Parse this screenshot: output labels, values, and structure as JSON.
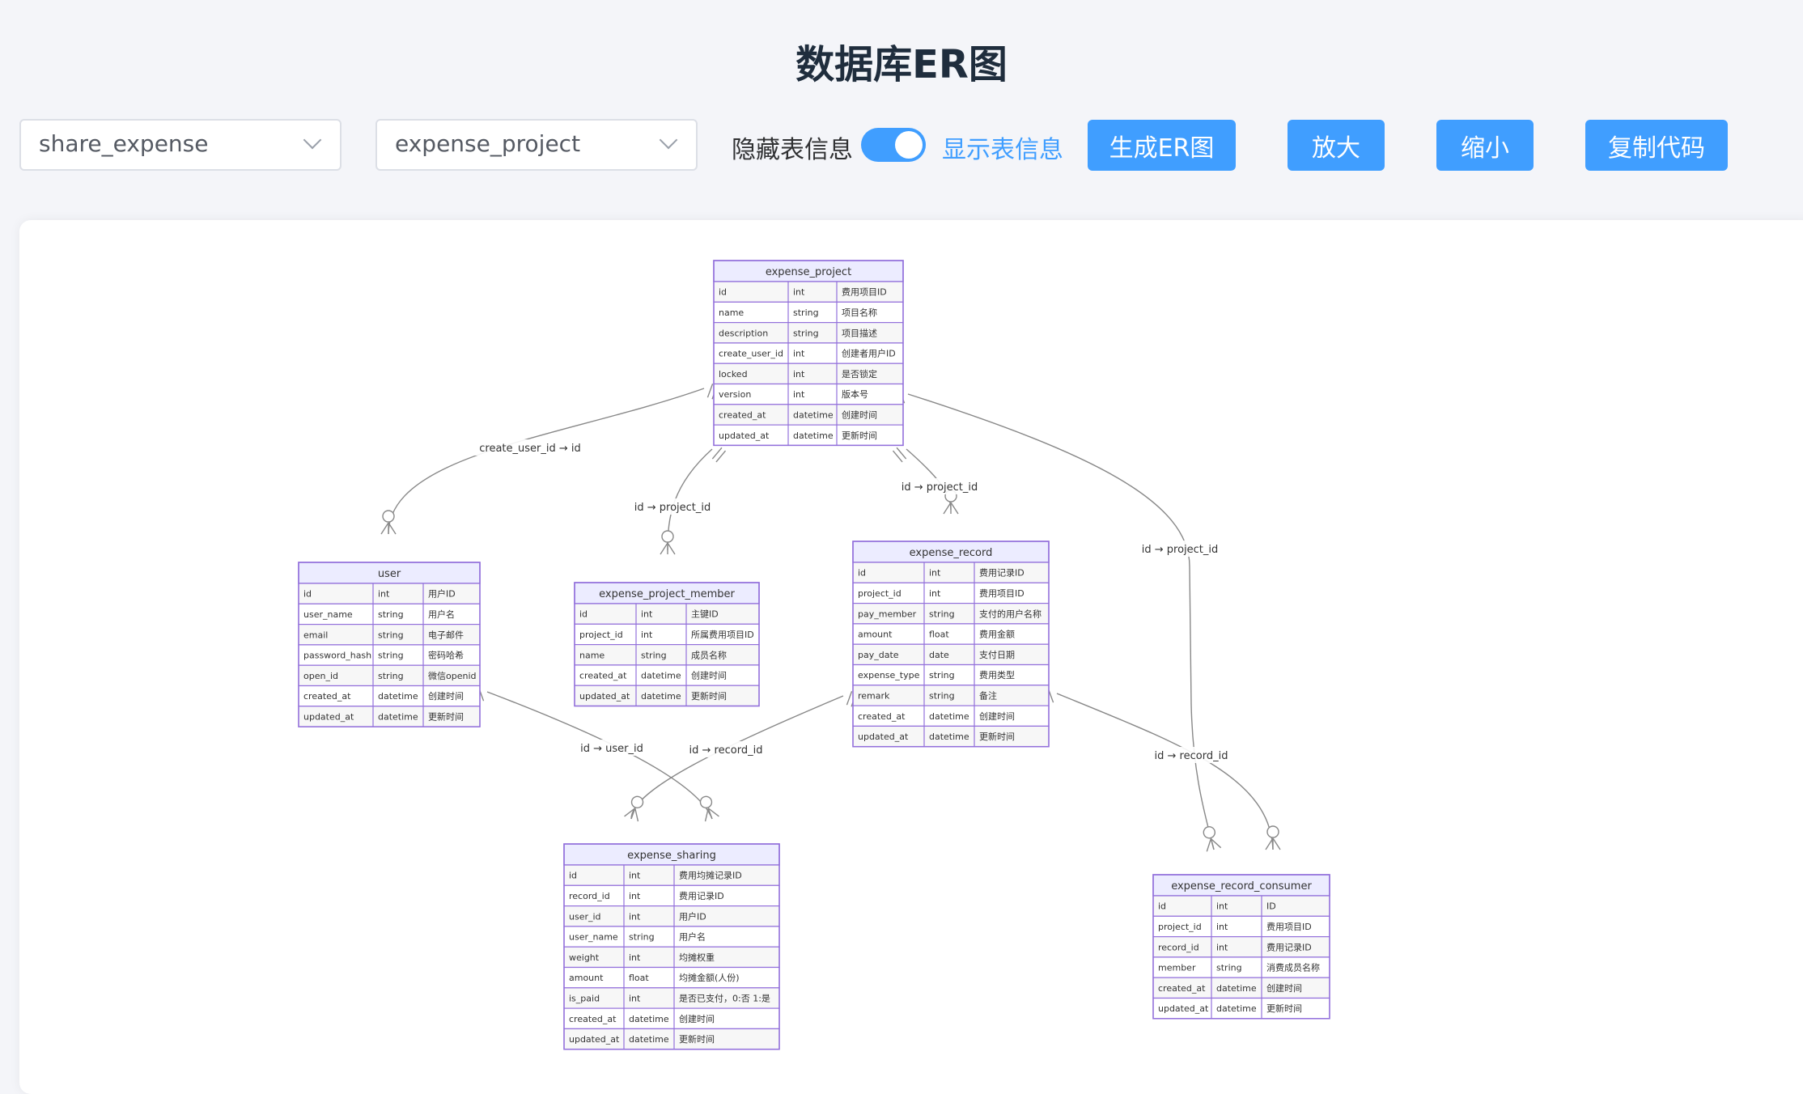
{
  "title": "数据库ER图",
  "db_select": {
    "value": "share_expense"
  },
  "table_select": {
    "value": "expense_project"
  },
  "toggle": {
    "off_label": "隐藏表信息",
    "on_label": "显示表信息"
  },
  "buttons": {
    "generate": "生成ER图",
    "zoom_in": "放大",
    "zoom_out": "缩小",
    "copy": "复制代码"
  },
  "colors": {
    "accent": "#409eff",
    "entity_header": "#ececff",
    "entity_border": "#9370db",
    "edge": "#888888"
  },
  "entities": [
    {
      "name": "expense_project",
      "rows": [
        [
          "id",
          "int",
          "费用项目ID"
        ],
        [
          "name",
          "string",
          "项目名称"
        ],
        [
          "description",
          "string",
          "项目描述"
        ],
        [
          "create_user_id",
          "int",
          "创建者用户ID"
        ],
        [
          "locked",
          "int",
          "是否锁定"
        ],
        [
          "version",
          "int",
          "版本号"
        ],
        [
          "created_at",
          "datetime",
          "创建时间"
        ],
        [
          "updated_at",
          "datetime",
          "更新时间"
        ]
      ]
    },
    {
      "name": "user",
      "rows": [
        [
          "id",
          "int",
          "用户ID"
        ],
        [
          "user_name",
          "string",
          "用户名"
        ],
        [
          "email",
          "string",
          "电子邮件"
        ],
        [
          "password_hash",
          "string",
          "密码哈希"
        ],
        [
          "open_id",
          "string",
          "微信openid"
        ],
        [
          "created_at",
          "datetime",
          "创建时间"
        ],
        [
          "updated_at",
          "datetime",
          "更新时间"
        ]
      ]
    },
    {
      "name": "expense_project_member",
      "rows": [
        [
          "id",
          "int",
          "主键ID"
        ],
        [
          "project_id",
          "int",
          "所属费用项目ID"
        ],
        [
          "name",
          "string",
          "成员名称"
        ],
        [
          "created_at",
          "datetime",
          "创建时间"
        ],
        [
          "updated_at",
          "datetime",
          "更新时间"
        ]
      ]
    },
    {
      "name": "expense_record",
      "rows": [
        [
          "id",
          "int",
          "费用记录ID"
        ],
        [
          "project_id",
          "int",
          "费用项目ID"
        ],
        [
          "pay_member",
          "string",
          "支付的用户名称"
        ],
        [
          "amount",
          "float",
          "费用金额"
        ],
        [
          "pay_date",
          "date",
          "支付日期"
        ],
        [
          "expense_type",
          "string",
          "费用类型"
        ],
        [
          "remark",
          "string",
          "备注"
        ],
        [
          "created_at",
          "datetime",
          "创建时间"
        ],
        [
          "updated_at",
          "datetime",
          "更新时间"
        ]
      ]
    },
    {
      "name": "expense_sharing",
      "rows": [
        [
          "id",
          "int",
          "费用均摊记录ID"
        ],
        [
          "record_id",
          "int",
          "费用记录ID"
        ],
        [
          "user_id",
          "int",
          "用户ID"
        ],
        [
          "user_name",
          "string",
          "用户名"
        ],
        [
          "weight",
          "int",
          "均摊权重"
        ],
        [
          "amount",
          "float",
          "均摊金额(人份)"
        ],
        [
          "is_paid",
          "int",
          "是否已支付，0:否 1:是"
        ],
        [
          "created_at",
          "datetime",
          "创建时间"
        ],
        [
          "updated_at",
          "datetime",
          "更新时间"
        ]
      ]
    },
    {
      "name": "expense_record_consumer",
      "rows": [
        [
          "id",
          "int",
          "ID"
        ],
        [
          "project_id",
          "int",
          "费用项目ID"
        ],
        [
          "record_id",
          "int",
          "费用记录ID"
        ],
        [
          "member",
          "string",
          "消费成员名称"
        ],
        [
          "created_at",
          "datetime",
          "创建时间"
        ],
        [
          "updated_at",
          "datetime",
          "更新时间"
        ]
      ]
    }
  ],
  "relations": [
    {
      "label": "create_user_id → id"
    },
    {
      "label": "id → project_id"
    },
    {
      "label": "id → project_id"
    },
    {
      "label": "id → project_id"
    },
    {
      "label": "id → user_id"
    },
    {
      "label": "id → record_id"
    },
    {
      "label": "id → record_id"
    }
  ]
}
